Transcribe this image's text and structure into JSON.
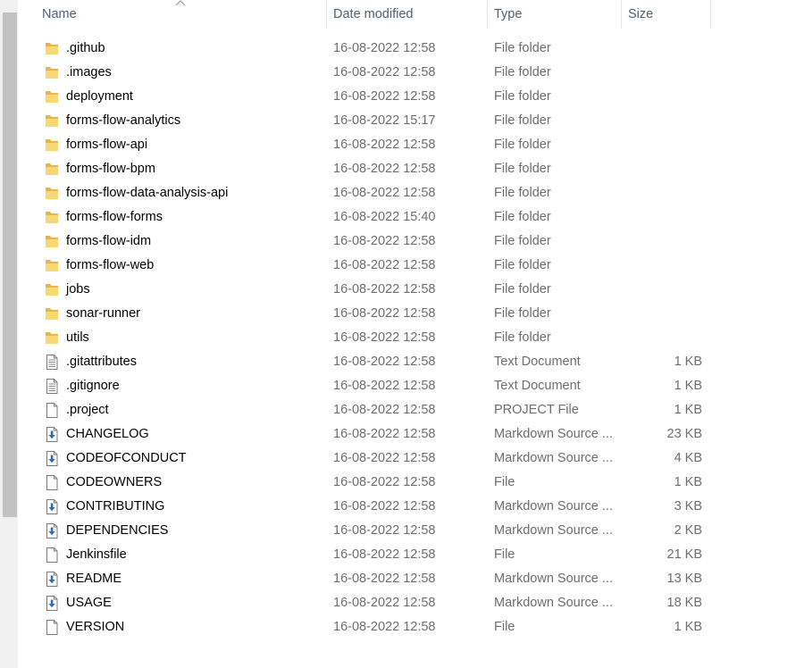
{
  "columns": {
    "name": "Name",
    "date": "Date modified",
    "type": "Type",
    "size": "Size"
  },
  "files": [
    {
      "name": ".github",
      "date": "16-08-2022 12:58",
      "type": "File folder",
      "size": "",
      "icon": "folder-icon"
    },
    {
      "name": ".images",
      "date": "16-08-2022 12:58",
      "type": "File folder",
      "size": "",
      "icon": "folder-icon"
    },
    {
      "name": "deployment",
      "date": "16-08-2022 12:58",
      "type": "File folder",
      "size": "",
      "icon": "folder-icon"
    },
    {
      "name": "forms-flow-analytics",
      "date": "16-08-2022 15:17",
      "type": "File folder",
      "size": "",
      "icon": "folder-icon"
    },
    {
      "name": "forms-flow-api",
      "date": "16-08-2022 12:58",
      "type": "File folder",
      "size": "",
      "icon": "folder-icon"
    },
    {
      "name": "forms-flow-bpm",
      "date": "16-08-2022 12:58",
      "type": "File folder",
      "size": "",
      "icon": "folder-icon"
    },
    {
      "name": "forms-flow-data-analysis-api",
      "date": "16-08-2022 12:58",
      "type": "File folder",
      "size": "",
      "icon": "folder-icon"
    },
    {
      "name": "forms-flow-forms",
      "date": "16-08-2022 15:40",
      "type": "File folder",
      "size": "",
      "icon": "folder-icon"
    },
    {
      "name": "forms-flow-idm",
      "date": "16-08-2022 12:58",
      "type": "File folder",
      "size": "",
      "icon": "folder-icon"
    },
    {
      "name": "forms-flow-web",
      "date": "16-08-2022 12:58",
      "type": "File folder",
      "size": "",
      "icon": "folder-icon"
    },
    {
      "name": "jobs",
      "date": "16-08-2022 12:58",
      "type": "File folder",
      "size": "",
      "icon": "folder-icon"
    },
    {
      "name": "sonar-runner",
      "date": "16-08-2022 12:58",
      "type": "File folder",
      "size": "",
      "icon": "folder-icon"
    },
    {
      "name": "utils",
      "date": "16-08-2022 12:58",
      "type": "File folder",
      "size": "",
      "icon": "folder-icon"
    },
    {
      "name": ".gitattributes",
      "date": "16-08-2022 12:58",
      "type": "Text Document",
      "size": "1 KB",
      "icon": "text-document-icon"
    },
    {
      "name": ".gitignore",
      "date": "16-08-2022 12:58",
      "type": "Text Document",
      "size": "1 KB",
      "icon": "text-document-icon"
    },
    {
      "name": ".project",
      "date": "16-08-2022 12:58",
      "type": "PROJECT File",
      "size": "1 KB",
      "icon": "file-icon"
    },
    {
      "name": "CHANGELOG",
      "date": "16-08-2022 12:58",
      "type": "Markdown Source ...",
      "size": "23 KB",
      "icon": "markdown-file-icon"
    },
    {
      "name": "CODEOFCONDUCT",
      "date": "16-08-2022 12:58",
      "type": "Markdown Source ...",
      "size": "4 KB",
      "icon": "markdown-file-icon"
    },
    {
      "name": "CODEOWNERS",
      "date": "16-08-2022 12:58",
      "type": "File",
      "size": "1 KB",
      "icon": "file-icon"
    },
    {
      "name": "CONTRIBUTING",
      "date": "16-08-2022 12:58",
      "type": "Markdown Source ...",
      "size": "3 KB",
      "icon": "markdown-file-icon"
    },
    {
      "name": "DEPENDENCIES",
      "date": "16-08-2022 12:58",
      "type": "Markdown Source ...",
      "size": "2 KB",
      "icon": "markdown-file-icon"
    },
    {
      "name": "Jenkinsfile",
      "date": "16-08-2022 12:58",
      "type": "File",
      "size": "21 KB",
      "icon": "file-icon"
    },
    {
      "name": "README",
      "date": "16-08-2022 12:58",
      "type": "Markdown Source ...",
      "size": "13 KB",
      "icon": "markdown-file-icon"
    },
    {
      "name": "USAGE",
      "date": "16-08-2022 12:58",
      "type": "Markdown Source ...",
      "size": "18 KB",
      "icon": "markdown-file-icon"
    },
    {
      "name": "VERSION",
      "date": "16-08-2022 12:58",
      "type": "File",
      "size": "1 KB",
      "icon": "file-icon"
    }
  ],
  "colors": {
    "folder": "#f8d775",
    "header_text": "#4c607a",
    "detail_text": "#6d6d6d",
    "markdown_arrow": "#2b6cb0"
  }
}
